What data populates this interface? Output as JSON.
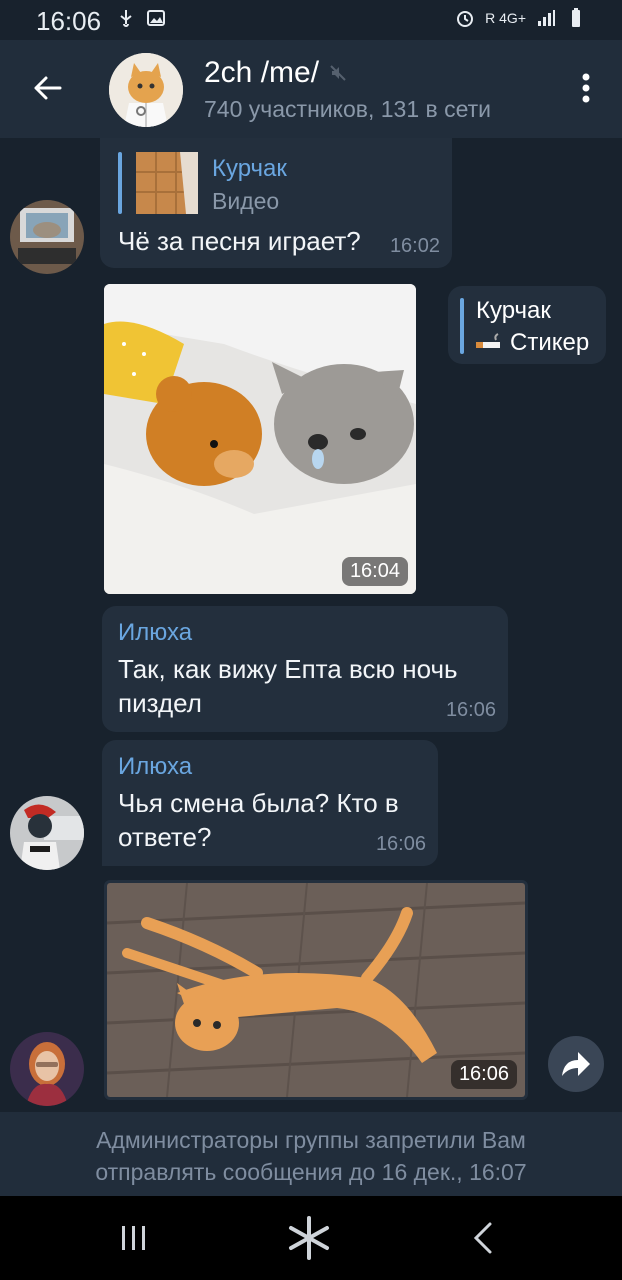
{
  "status": {
    "time": "16:06",
    "right_text": "R 4G+"
  },
  "header": {
    "title": "2ch /me/",
    "subtitle": "740 участников, 131 в сети",
    "muted": true
  },
  "messages": [
    {
      "reply_sender": "Курчак",
      "reply_type": "Видео",
      "text": "Чё за песня играет?",
      "time": "16:02"
    },
    {
      "media_time": "16:04",
      "reply_sender": "Курчак",
      "reply_type": "Стикер"
    },
    {
      "sender": "Илюха",
      "text": "Так, как вижу Епта всю ночь пиздел",
      "time": "16:06"
    },
    {
      "sender": "Илюха",
      "text": "Чья смена была? Кто в ответе?",
      "time": "16:06"
    },
    {
      "media_time": "16:06"
    }
  ],
  "restriction": {
    "line1": "Администраторы группы запретили Вам",
    "line2": "отправлять сообщения до 16 дек., 16:07"
  },
  "colors": {
    "background": "#18222d",
    "header": "#212d3b",
    "bubble": "#232f3d",
    "accent": "#6aa6e0",
    "muted_text": "#8a98a9"
  },
  "icons": {
    "back": "arrow-left-icon",
    "menu": "more-vertical-icon",
    "forward": "share-arrow-icon",
    "mute": "mute-icon"
  }
}
